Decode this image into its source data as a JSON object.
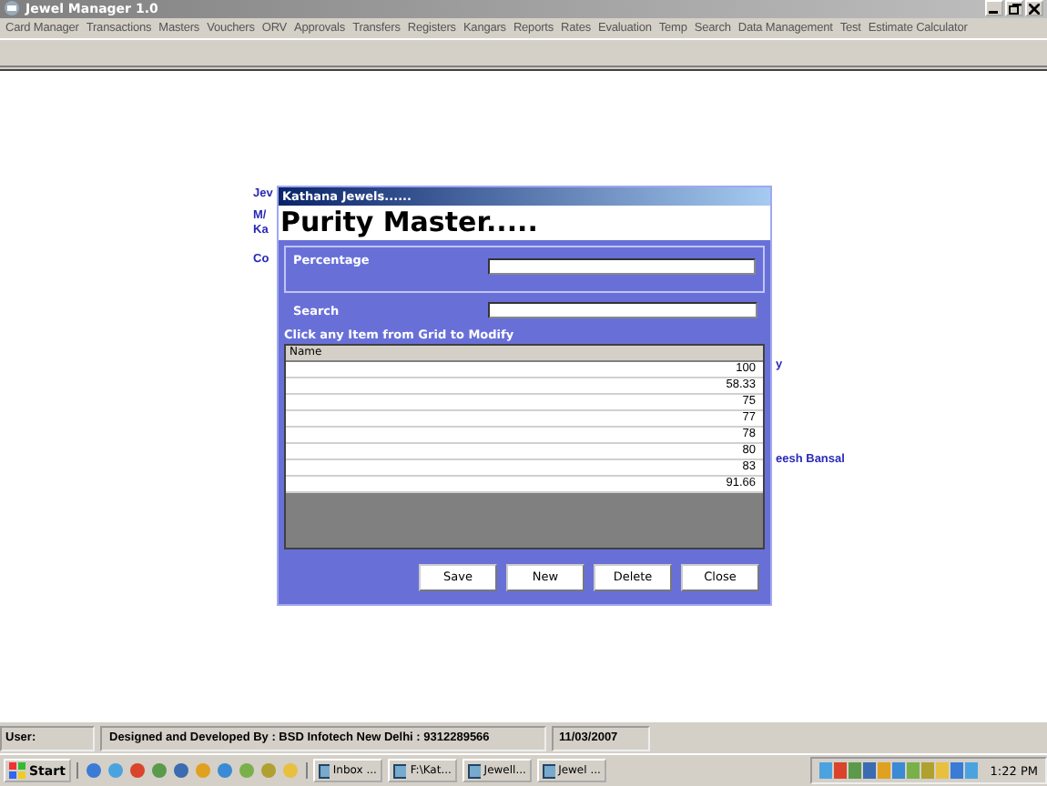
{
  "window": {
    "title": "Jewel Manager 1.0"
  },
  "menu": [
    "Card Manager",
    "Transactions",
    "Masters",
    "Vouchers",
    "ORV",
    "Approvals",
    "Transfers",
    "Registers",
    "Kangars",
    "Reports",
    "Rates",
    "Evaluation",
    "Temp",
    "Search",
    "Data Management",
    "Test",
    "Estimate Calculator"
  ],
  "background_texts": [
    "Jev",
    "M/",
    "Ka",
    "Co",
    "y",
    "eesh Bansal"
  ],
  "dialog": {
    "title": "Kathana Jewels......",
    "heading": "Purity Master.....",
    "percentage": {
      "label": "Percentage"
    },
    "search": {
      "label": "Search"
    },
    "hint": "Click any Item from Grid to Modify",
    "table": {
      "columns": [
        "Name"
      ],
      "rows": [
        "100",
        "58.33",
        "75",
        "77",
        "78",
        "80",
        "83",
        "91.66"
      ]
    },
    "buttons": [
      "Save",
      "New",
      "Delete",
      "Close"
    ]
  },
  "status_bar": [
    "User:",
    "Designed and Developed By : BSD Infotech New Delhi : 9312289566",
    "11/03/2007"
  ],
  "taskbar": {
    "start": "Start",
    "tasks": [
      "Inbox ...",
      "F:\\Kat...",
      "Jewell...",
      "Jewel ..."
    ],
    "clock": "1:22 PM"
  }
}
